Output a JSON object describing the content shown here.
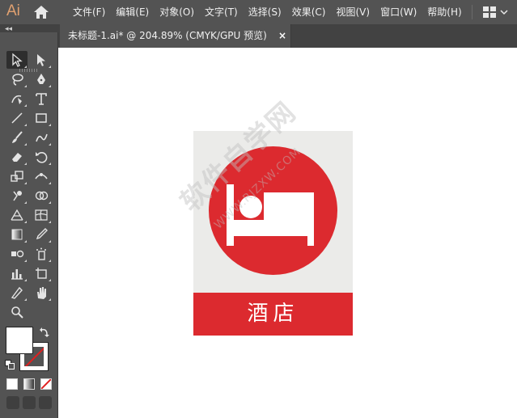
{
  "app": {
    "logo": "Ai"
  },
  "menu": [
    "文件(F)",
    "编辑(E)",
    "对象(O)",
    "文字(T)",
    "选择(S)",
    "效果(C)",
    "视图(V)",
    "窗口(W)",
    "帮助(H)"
  ],
  "tab_row": {
    "collapse_arrows": "◂◂"
  },
  "document_tab": {
    "title": "未标题-1.ai* @ 204.89% (CMYK/GPU 预览)",
    "close": "×"
  },
  "tools": [
    "selection-tool",
    "direct-selection-tool",
    "lasso-tool",
    "pen-tool",
    "curvature-tool",
    "type-tool",
    "line-segment-tool",
    "rectangle-tool",
    "paintbrush-tool",
    "shaper-tool",
    "eraser-tool",
    "rotate-tool",
    "scale-tool",
    "width-tool",
    "puppet-warp-tool",
    "shape-builder-tool",
    "perspective-grid-tool",
    "mesh-tool",
    "gradient-tool",
    "eyedropper-tool",
    "blend-tool",
    "symbol-sprayer-tool",
    "column-graph-tool",
    "artboard-tool",
    "slice-tool",
    "hand-tool",
    "zoom-tool"
  ],
  "artwork": {
    "sign_label": "酒店",
    "sign_color": "#dc2a2f",
    "sign_background": "#ebebe9",
    "watermark": "软件自学网",
    "watermark_url": "WWW.RJZXW.COM"
  },
  "colors": {
    "menubar": "#535353",
    "tabrow": "#424242",
    "fill": "#ffffff",
    "stroke": "none"
  }
}
